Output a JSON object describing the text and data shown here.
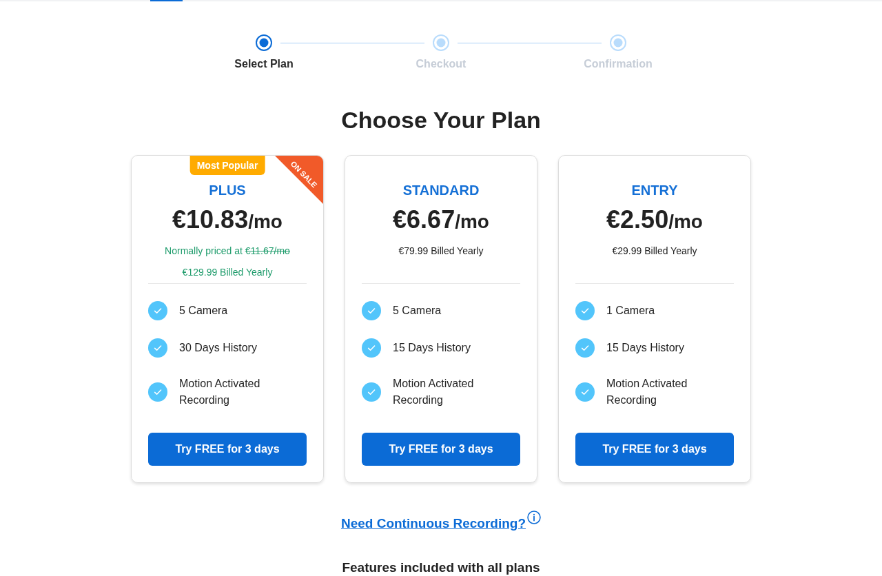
{
  "stepper": {
    "steps": [
      {
        "label": "Select Plan",
        "selected": true
      },
      {
        "label": "Checkout",
        "selected": false
      },
      {
        "label": "Confirmation",
        "selected": false
      }
    ]
  },
  "title": "Choose Your Plan",
  "plans": [
    {
      "badge": "Most Popular",
      "ribbon": "ON SALE",
      "name": "PLUS",
      "price": "€10.83",
      "period": "/mo",
      "regular_price_label": "Normally priced at",
      "regular_price": "€11.67/mo",
      "billing": "€129.99 Billed Yearly",
      "discounted": true,
      "features": [
        "5 Camera",
        "30 Days History",
        "Motion Activated Recording"
      ],
      "button": "Try FREE for 3 days"
    },
    {
      "name": "STANDARD",
      "price": "€6.67",
      "period": "/mo",
      "billing": "€79.99 Billed Yearly",
      "discounted": false,
      "features": [
        "5 Camera",
        "15 Days History",
        "Motion Activated Recording"
      ],
      "button": "Try FREE for 3 days"
    },
    {
      "name": "ENTRY",
      "price": "€2.50",
      "period": "/mo",
      "billing": "€29.99 Billed Yearly",
      "discounted": false,
      "features": [
        "1 Camera",
        "15 Days History",
        "Motion Activated Recording"
      ],
      "button": "Try FREE for 3 days"
    }
  ],
  "continuous_link": "Need Continuous Recording?",
  "features_heading": "Features included with all plans"
}
